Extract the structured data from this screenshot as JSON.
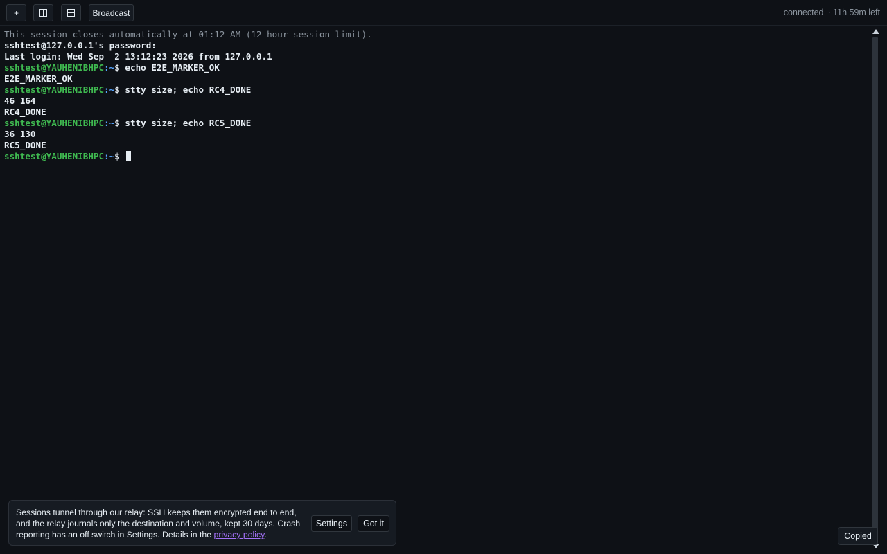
{
  "toolbar": {
    "new_tab_label": "+",
    "split_vertical_icon": "split-vertical-icon",
    "split_horizontal_icon": "split-horizontal-icon",
    "broadcast_label": "Broadcast"
  },
  "status": {
    "connection": "connected",
    "time_left": "· 11h 59m left"
  },
  "terminal": {
    "lines": [
      {
        "kind": "dim",
        "text": "This session closes automatically at 01:12 AM (12-hour session limit)."
      },
      {
        "kind": "out",
        "text": "sshtest@127.0.0.1's password:"
      },
      {
        "kind": "out",
        "text": "Last login: Wed Sep  2 13:12:23 2026 from 127.0.0.1"
      },
      {
        "kind": "prompt",
        "user": "sshtest@YAUHENIBHPC",
        "path": ":~",
        "cmd": "$ echo E2E_MARKER_OK"
      },
      {
        "kind": "out",
        "text": "E2E_MARKER_OK"
      },
      {
        "kind": "prompt",
        "user": "sshtest@YAUHENIBHPC",
        "path": ":~",
        "cmd": "$ stty size; echo RC4_DONE"
      },
      {
        "kind": "out",
        "text": "46 164"
      },
      {
        "kind": "out",
        "text": "RC4_DONE"
      },
      {
        "kind": "prompt",
        "user": "sshtest@YAUHENIBHPC",
        "path": ":~",
        "cmd": "$ stty size; echo RC5_DONE"
      },
      {
        "kind": "out",
        "text": "36 130"
      },
      {
        "kind": "out",
        "text": "RC5_DONE"
      },
      {
        "kind": "prompt",
        "user": "sshtest@YAUHENIBHPC",
        "path": ":~",
        "cmd": "$ "
      }
    ]
  },
  "notice": {
    "text_before_link": "Sessions tunnel through our relay: SSH keeps them encrypted end to end, and the relay journals only the destination and volume, kept 30 days. Crash reporting has an off switch in Settings. Details in the ",
    "link_text": "privacy policy",
    "text_after_link": ".",
    "settings_label": "Settings",
    "dismiss_label": "Got it"
  },
  "toast": {
    "text": "Copied"
  },
  "colors": {
    "background": "#0e1116",
    "prompt_user": "#3fb950",
    "prompt_path": "#58a6ff",
    "link": "#a371f7"
  }
}
